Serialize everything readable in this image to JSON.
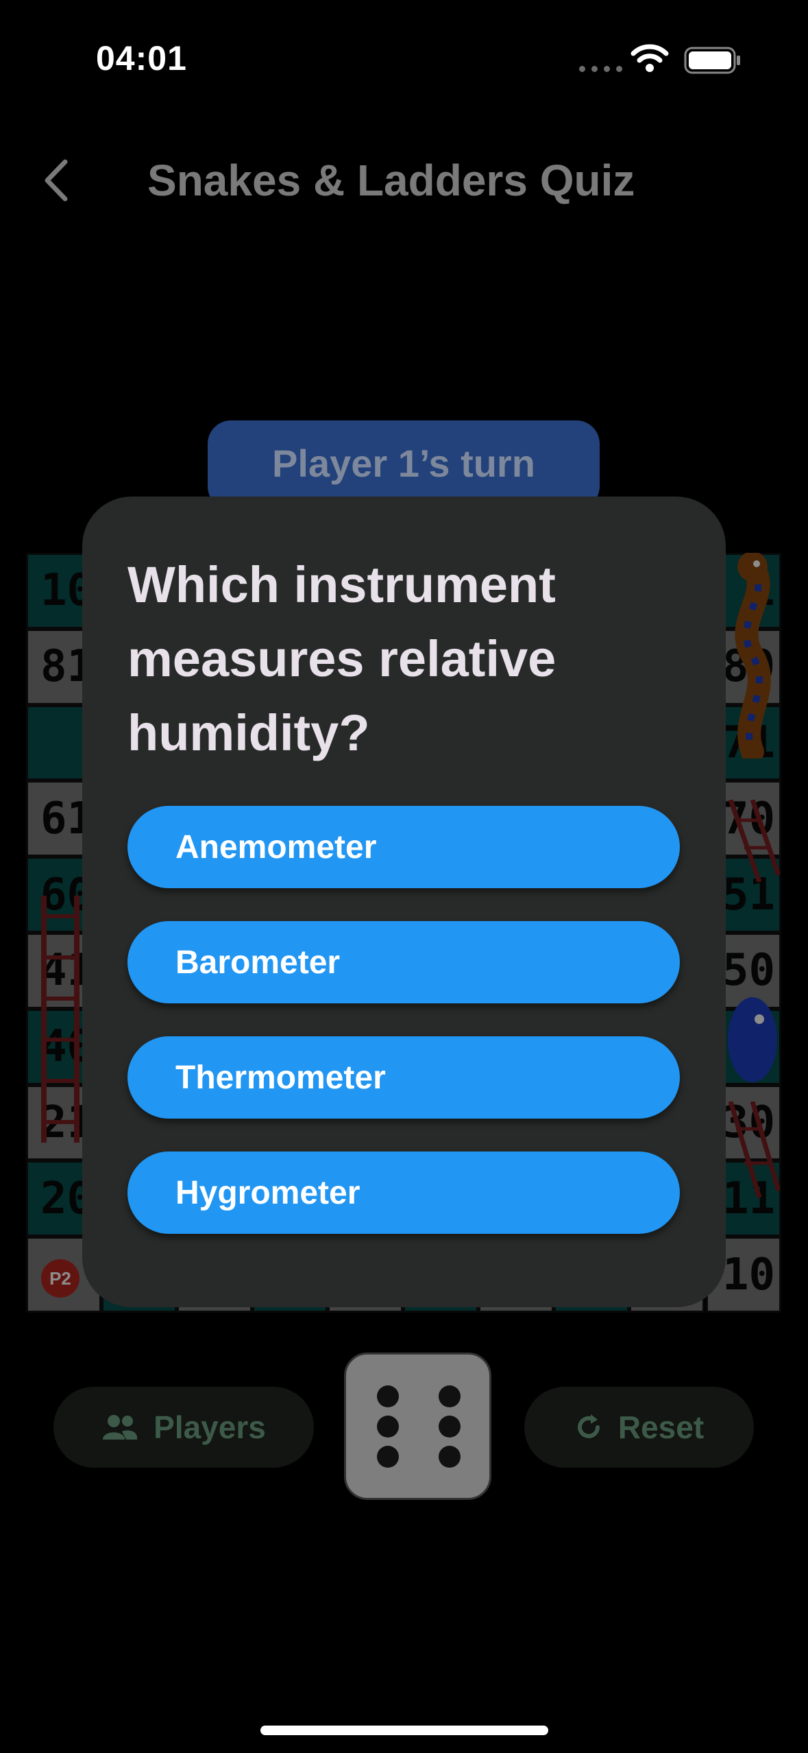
{
  "status_bar": {
    "time": "04:01"
  },
  "nav": {
    "title": "Snakes & Ladders Quiz"
  },
  "turn_banner": {
    "text": "Player 1’s turn"
  },
  "board": {
    "left_column": [
      "10",
      "81",
      "",
      "61",
      "60",
      "41",
      "40",
      "21",
      "20",
      ""
    ],
    "right_column": [
      "1",
      "80",
      "71",
      "70",
      "51",
      "50",
      "",
      "30",
      "11",
      "10"
    ],
    "player_token": "P2",
    "colors": {
      "dark_cell": "#06504e",
      "light_cell": "#7a7a7a",
      "ladder": "#7a1f1f",
      "snake": "#1e3fbf"
    }
  },
  "quiz": {
    "question": "Which instrument measures relative humidity?",
    "options": [
      "Anemometer",
      "Barometer",
      "Thermometer",
      "Hygrometer"
    ],
    "accent_color": "#2196f3"
  },
  "controls": {
    "players_label": "Players",
    "players_icon": "people-icon",
    "reset_label": "Reset",
    "reset_icon": "refresh-icon",
    "dice_value": 6
  }
}
